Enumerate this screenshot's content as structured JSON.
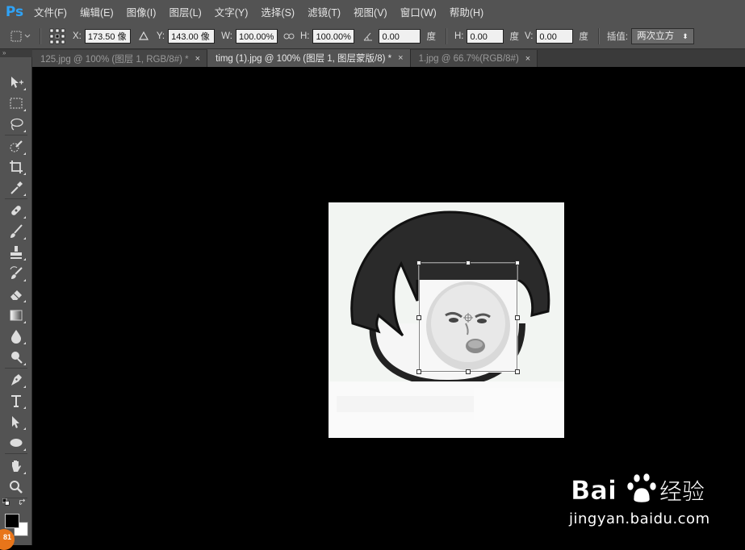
{
  "app": {
    "logo": "Ps"
  },
  "menu": [
    "文件(F)",
    "编辑(E)",
    "图像(I)",
    "图层(L)",
    "文字(Y)",
    "选择(S)",
    "滤镜(T)",
    "视图(V)",
    "窗口(W)",
    "帮助(H)"
  ],
  "options": {
    "x_label": "X:",
    "x_value": "173.50 像",
    "y_label": "Y:",
    "y_value": "143.00 像",
    "w_label": "W:",
    "w_value": "100.00%",
    "h_label": "H:",
    "h_value": "100.00%",
    "angle_value": "0.00",
    "angle_unit": "度",
    "hskew_label": "H:",
    "hskew_value": "0.00",
    "hskew_unit": "度",
    "vskew_label": "V:",
    "vskew_value": "0.00",
    "vskew_unit": "度",
    "interp_label": "插值:",
    "interp_value": "两次立方",
    "interp_arrow": "⬍"
  },
  "tabs": [
    {
      "title": "125.jpg @ 100% (图层 1, RGB/8#) *",
      "close": "×",
      "active": false
    },
    {
      "title": "timg (1).jpg @ 100% (图层 1, 图层蒙版/8) *",
      "close": "×",
      "active": true
    },
    {
      "title": "1.jpg @ 66.7%(RGB/8#)",
      "close": "×",
      "active": false
    }
  ],
  "panel": {
    "collapse_glyph": "»"
  },
  "swatches": {
    "foreground": "#000000",
    "background": "#ffffff"
  },
  "badge": {
    "text": "81"
  },
  "watermark": {
    "brand_left": "Bai",
    "brand_right": "经验",
    "url": "jingyan.baidu.com"
  },
  "colors": {
    "ui_gray": "#535353",
    "ps_blue": "#2fa3f7",
    "canvas": "#000000"
  },
  "icons": [
    "move-icon",
    "marquee-icon",
    "lasso-icon",
    "quick-select-icon",
    "crop-icon",
    "eyedropper-icon",
    "healing-icon",
    "brush-icon",
    "stamp-icon",
    "history-brush-icon",
    "eraser-icon",
    "gradient-icon",
    "blur-icon",
    "dodge-icon",
    "pen-icon",
    "type-icon",
    "path-select-icon",
    "ellipse-icon",
    "hand-icon",
    "zoom-icon",
    "reference-point-icon",
    "triangle-icon",
    "link-icon"
  ]
}
